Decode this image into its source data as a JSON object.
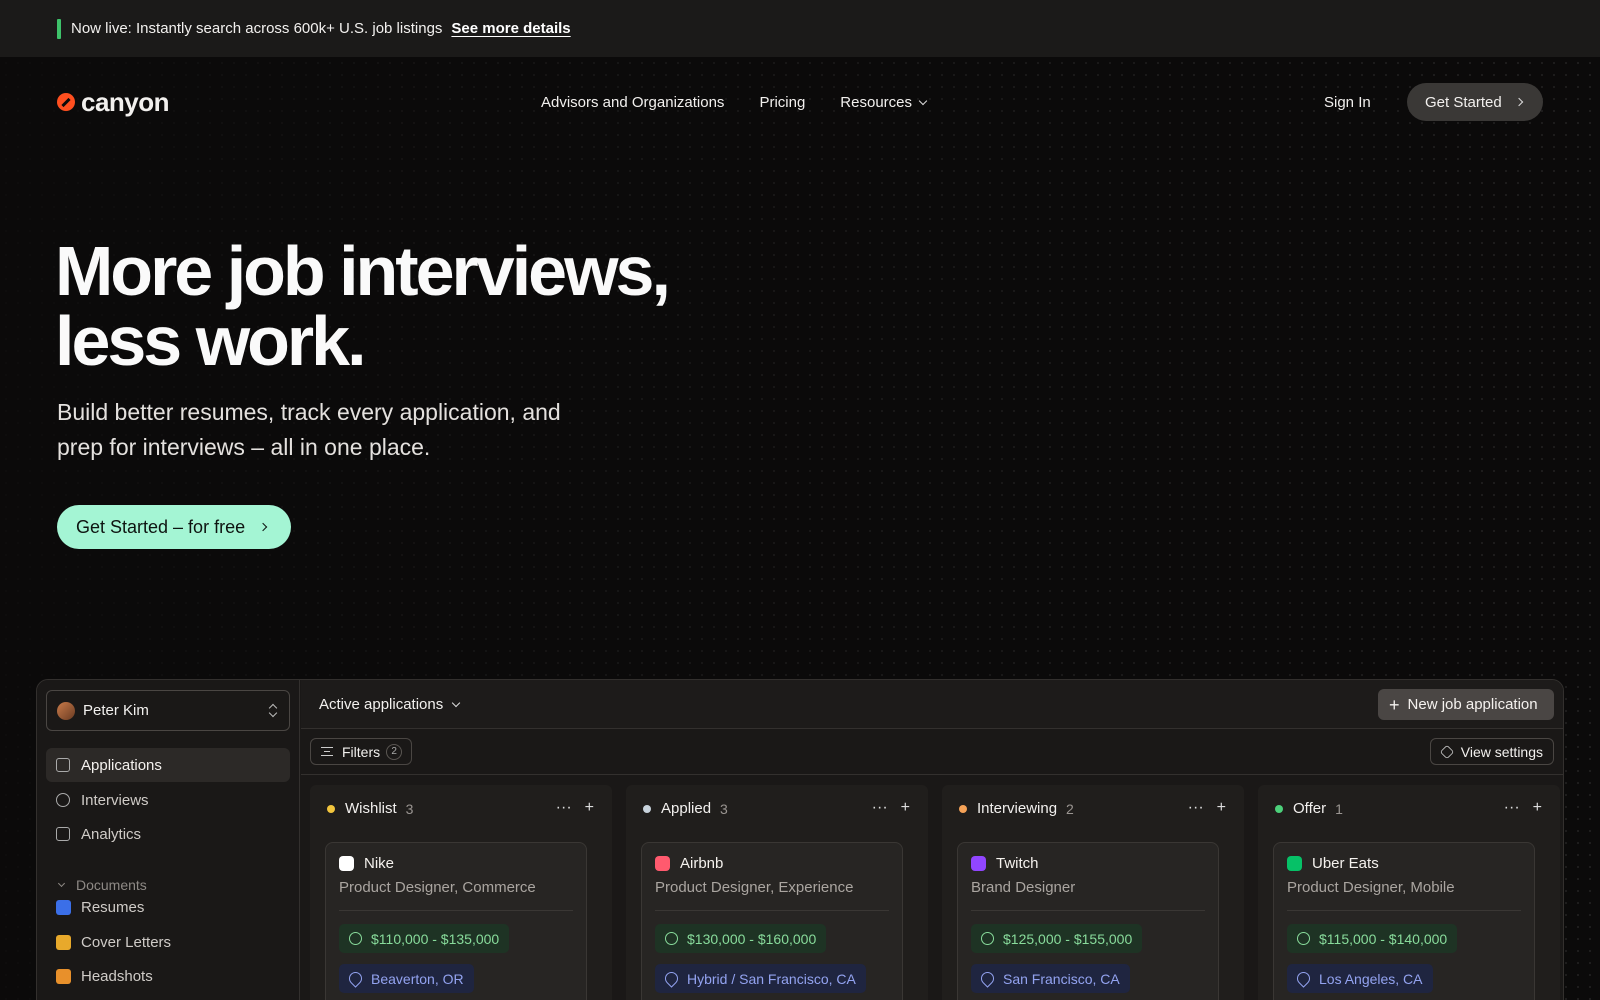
{
  "announcement": {
    "text": "Now live: Instantly search across 600k+ U.S. job listings",
    "link": "See more details",
    "accent": "#3ec26a"
  },
  "nav": {
    "brand": "canyon",
    "links": [
      "Advisors and Organizations",
      "Pricing",
      "Resources"
    ],
    "sign_in": "Sign In",
    "get_started": "Get Started"
  },
  "hero": {
    "title_line1": "More job interviews,",
    "title_line2": "less work.",
    "subtitle_line1": "Build better resumes, track every application, and",
    "subtitle_line2": "prep for interviews – all in one place.",
    "cta": "Get Started – for free",
    "cta_color": "#a4f5d4"
  },
  "app": {
    "user": "Peter Kim",
    "sidebar": {
      "items": [
        "Applications",
        "Interviews",
        "Analytics"
      ],
      "documents_label": "Documents",
      "documents": [
        {
          "label": "Resumes",
          "color": "#3b6fe8"
        },
        {
          "label": "Cover Letters",
          "color": "#e8a92b"
        },
        {
          "label": "Headshots",
          "color": "#e8902b"
        }
      ]
    },
    "view_title": "Active applications",
    "new_button": "New job application",
    "filters_label": "Filters",
    "filters_count": "2",
    "view_settings": "View settings",
    "columns": [
      {
        "name": "Wishlist",
        "count": "3",
        "color": "#f2c53d",
        "card": {
          "company": "Nike",
          "role": "Product Designer, Commerce",
          "salary": "$110,000 - $135,000",
          "location": "Beaverton, OR",
          "logo_color": "#ffffff"
        }
      },
      {
        "name": "Applied",
        "count": "3",
        "color": "#c8d3dc",
        "card": {
          "company": "Airbnb",
          "role": "Product Designer, Experience",
          "salary": "$130,000 - $160,000",
          "location": "Hybrid / San Francisco, CA",
          "logo_color": "#ff5a6e"
        }
      },
      {
        "name": "Interviewing",
        "count": "2",
        "color": "#f5a257",
        "card": {
          "company": "Twitch",
          "role": "Brand Designer",
          "salary": "$125,000 - $155,000",
          "location": "San Francisco, CA",
          "logo_color": "#9146ff"
        }
      },
      {
        "name": "Offer",
        "count": "1",
        "color": "#4cd07a",
        "card": {
          "company": "Uber Eats",
          "role": "Product Designer, Mobile",
          "salary": "$115,000 - $140,000",
          "location": "Los Angeles, CA",
          "logo_color": "#06c167"
        }
      }
    ]
  }
}
